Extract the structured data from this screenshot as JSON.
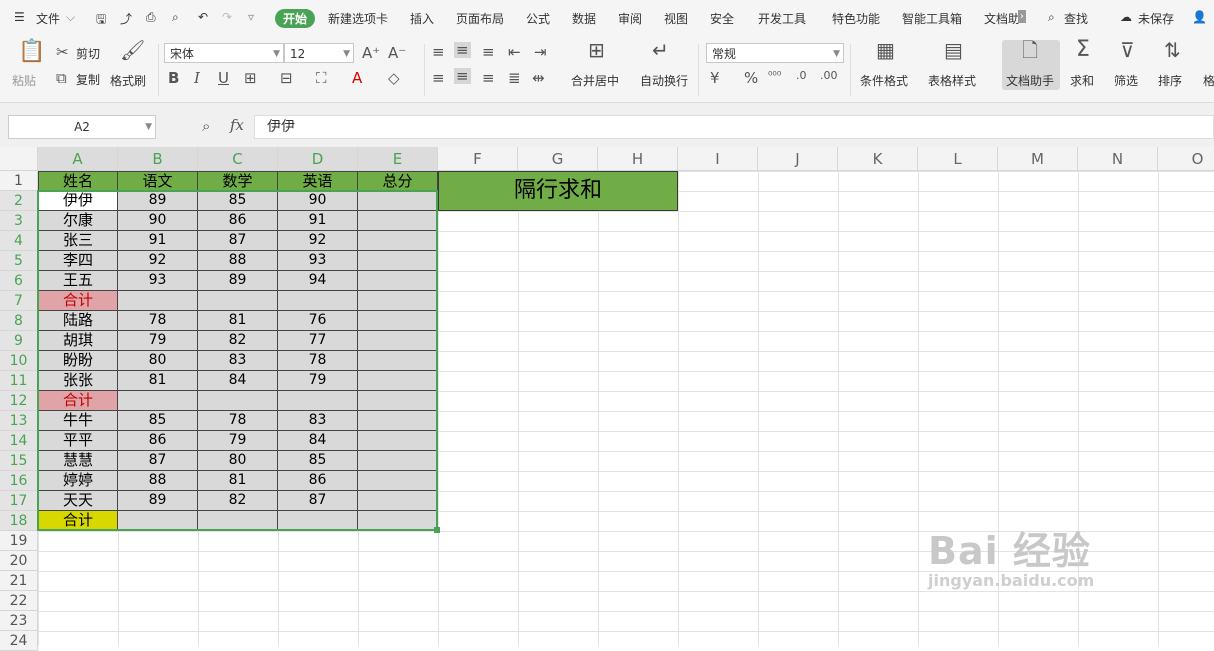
{
  "menu": {
    "file": "文件",
    "tabs": [
      "开始",
      "新建选项卡",
      "插入",
      "页面布局",
      "公式",
      "数据",
      "审阅",
      "视图",
      "安全",
      "开发工具",
      "特色功能",
      "智能工具箱",
      "文档助"
    ],
    "active_tab": "开始",
    "search": "查找",
    "unsaved": "未保存"
  },
  "ribbon": {
    "paste": "粘贴",
    "cut": "剪切",
    "copy": "复制",
    "format_painter": "格式刷",
    "font_name": "宋体",
    "font_size": "12",
    "merge_center": "合并居中",
    "wrap_text": "自动换行",
    "number_format": "常规",
    "percent": "%",
    "conditional_format": "条件格式",
    "table_style": "表格样式",
    "doc_assistant": "文档助手",
    "sum": "求和",
    "filter": "筛选",
    "sort": "排序",
    "more": "格"
  },
  "formula_bar": {
    "name_box": "A2",
    "fx": "fx",
    "value": "伊伊"
  },
  "columns": [
    "A",
    "B",
    "C",
    "D",
    "E",
    "F",
    "G",
    "H",
    "I",
    "J",
    "K",
    "L",
    "M",
    "N",
    "O"
  ],
  "rows": [
    "1",
    "2",
    "3",
    "4",
    "5",
    "6",
    "7",
    "8",
    "9",
    "10",
    "11",
    "12",
    "13",
    "14",
    "15",
    "16",
    "17",
    "18",
    "19",
    "20",
    "21",
    "22",
    "23",
    "24"
  ],
  "table": {
    "headers": [
      "姓名",
      "语文",
      "数学",
      "英语",
      "总分"
    ],
    "rows": [
      [
        "伊伊",
        "89",
        "85",
        "90",
        ""
      ],
      [
        "尔康",
        "90",
        "86",
        "91",
        ""
      ],
      [
        "张三",
        "91",
        "87",
        "92",
        ""
      ],
      [
        "李四",
        "92",
        "88",
        "93",
        ""
      ],
      [
        "王五",
        "93",
        "89",
        "94",
        ""
      ],
      [
        "合计",
        "",
        "",
        "",
        ""
      ],
      [
        "陆路",
        "78",
        "81",
        "76",
        ""
      ],
      [
        "胡琪",
        "79",
        "82",
        "77",
        ""
      ],
      [
        "盼盼",
        "80",
        "83",
        "78",
        ""
      ],
      [
        "张张",
        "81",
        "84",
        "79",
        ""
      ],
      [
        "合计",
        "",
        "",
        "",
        ""
      ],
      [
        "牛牛",
        "85",
        "78",
        "83",
        ""
      ],
      [
        "平平",
        "86",
        "79",
        "84",
        ""
      ],
      [
        "慧慧",
        "87",
        "80",
        "85",
        ""
      ],
      [
        "婷婷",
        "88",
        "81",
        "86",
        ""
      ],
      [
        "天天",
        "89",
        "82",
        "87",
        ""
      ],
      [
        "合计",
        "",
        "",
        "",
        ""
      ]
    ]
  },
  "title_box": "隔行求和",
  "watermark": {
    "line1": "Bai 经验",
    "line2": "jingyan.baidu.com"
  },
  "colors": {
    "green": "#70ad47",
    "pink": "#dfa3a8",
    "yellow": "#d8d800",
    "accent": "#4aa354"
  }
}
